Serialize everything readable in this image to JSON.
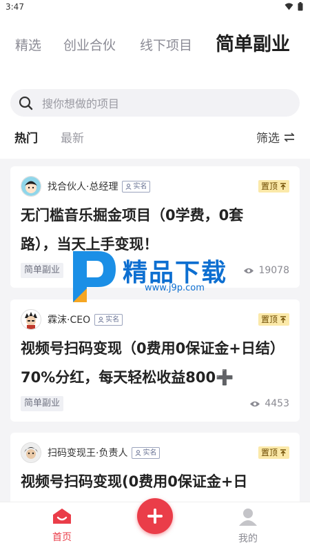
{
  "status_bar": {
    "time": "3:47"
  },
  "tabs": [
    {
      "label": "精选"
    },
    {
      "label": "创业合伙"
    },
    {
      "label": "线下项目"
    },
    {
      "label": "简单副业"
    }
  ],
  "search": {
    "placeholder": "搜你想做的项目"
  },
  "sort": {
    "hot": "热门",
    "new": "最新",
    "filter": "筛选"
  },
  "posts": [
    {
      "author": "找合伙人·总经理",
      "verified": "实名",
      "pinned": "置顶",
      "title_line1": "无门槛音乐掘金项目（0学费，0套",
      "title_line2": "路），当天上手变现！",
      "tag": "简单副业",
      "views": "19078"
    },
    {
      "author": "霖沫·CEO",
      "verified": "实名",
      "pinned": "置顶",
      "title_line1": "视频号扫码变现（0费用0保证金+日结）",
      "title_line2": "70%分红，每天轻松收益800➕",
      "tag": "简单副业",
      "views": "4453"
    },
    {
      "author": "扫码变现王·负责人",
      "verified": "实名",
      "pinned": "置顶",
      "title_line1": "视频号扫码变现(0费用0保证金+日",
      "title_line2": "",
      "tag": "",
      "views": ""
    }
  ],
  "watermark": {
    "name": "精品下载",
    "url": "www.j9p.com"
  },
  "bottom_nav": {
    "home": "首页",
    "mine": "我的"
  },
  "colors": {
    "accent": "#ea3d49",
    "pin_bg": "#fbe9a9"
  }
}
